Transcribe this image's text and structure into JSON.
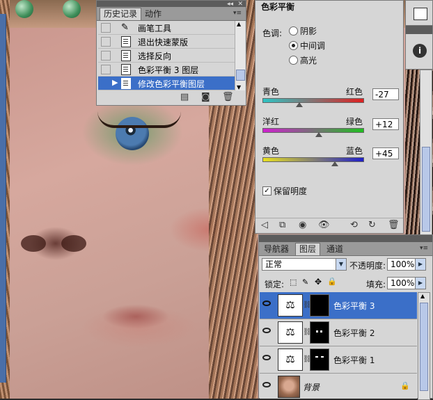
{
  "history_panel": {
    "tabs": [
      {
        "label": "历史记录",
        "active": true
      },
      {
        "label": "动作",
        "active": false
      }
    ],
    "items": [
      {
        "label": "画笔工具",
        "selected": false
      },
      {
        "label": "退出快速蒙版",
        "selected": false
      },
      {
        "label": "选择反向",
        "selected": false
      },
      {
        "label": "色彩平衡 3 图层",
        "selected": false
      },
      {
        "label": "修改色彩平衡图层",
        "selected": true
      }
    ]
  },
  "color_balance": {
    "title": "色彩平衡",
    "tone_label": "色调:",
    "tones": [
      {
        "label": "阴影",
        "selected": false
      },
      {
        "label": "中间调",
        "selected": true
      },
      {
        "label": "高光",
        "selected": false
      }
    ],
    "sliders": [
      {
        "left": "青色",
        "right": "红色",
        "value": "-27",
        "from": "#2ec4c4",
        "to": "#e02020",
        "amount": -27
      },
      {
        "left": "洋红",
        "right": "绿色",
        "value": "+12",
        "from": "#d020d0",
        "to": "#20c020",
        "amount": 12
      },
      {
        "left": "黄色",
        "right": "蓝色",
        "value": "+45",
        "from": "#e8e020",
        "to": "#2020c8",
        "amount": 45
      }
    ],
    "preserve_label": "保留明度",
    "preserve_checked": true
  },
  "layers_panel": {
    "tabs": [
      {
        "label": "导航器",
        "active": false
      },
      {
        "label": "图层",
        "active": true
      },
      {
        "label": "通道",
        "active": false
      }
    ],
    "blend_mode": "正常",
    "opacity_label": "不透明度:",
    "opacity_value": "100%",
    "lock_label": "锁定:",
    "fill_label": "填充:",
    "fill_value": "100%",
    "layers": [
      {
        "name": "色彩平衡 3",
        "selected": true
      },
      {
        "name": "色彩平衡 2",
        "selected": false
      },
      {
        "name": "色彩平衡 1",
        "selected": false
      },
      {
        "name": "背景",
        "selected": false
      }
    ]
  },
  "colors": {
    "selection": "#3b6fc8",
    "panel": "#d6d6d6"
  }
}
